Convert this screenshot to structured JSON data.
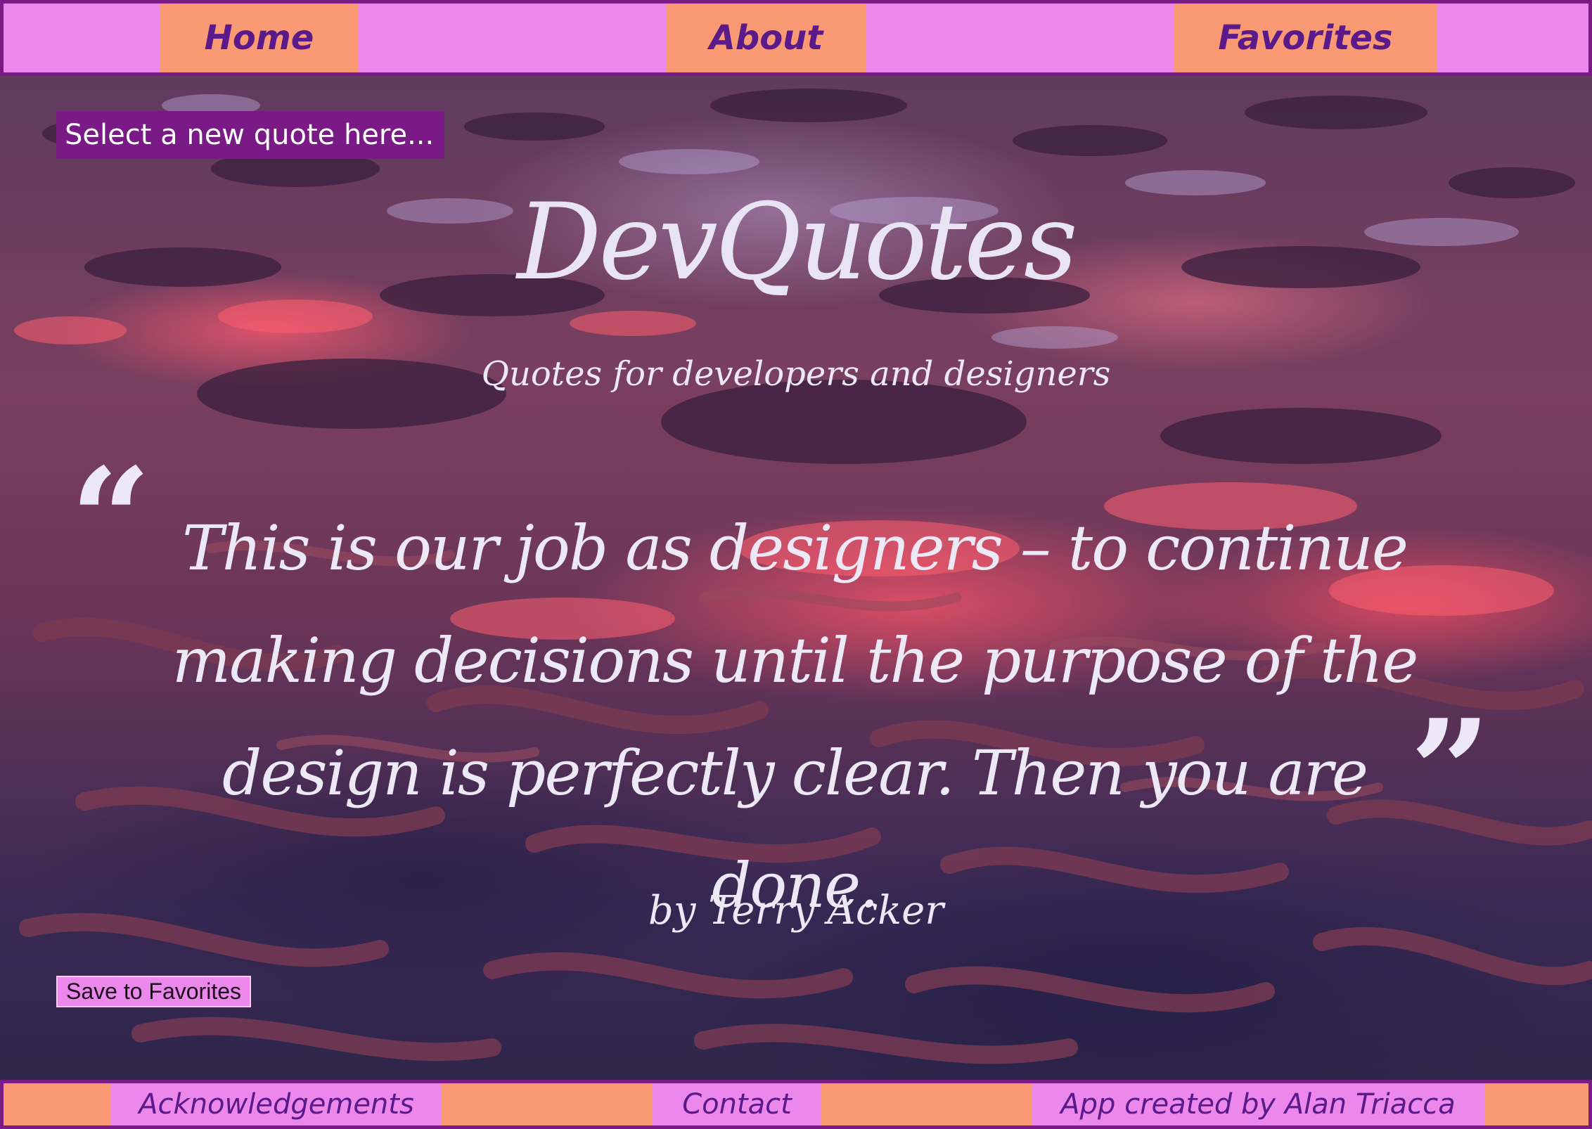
{
  "nav": {
    "home": "Home",
    "about": "About",
    "favorites": "Favorites"
  },
  "controls": {
    "select_quote": "Select a new quote here...",
    "save_favorites": "Save to Favorites"
  },
  "header": {
    "title": "DevQuotes",
    "subtitle": "Quotes for developers and designers"
  },
  "quote": {
    "open_mark": "“",
    "text": "This is our job as designers – to continue making decisions until the purpose of the design is perfectly clear. Then you are done.",
    "close_mark": "”",
    "author": "by Terry Acker"
  },
  "footer": {
    "acknowledgements": "Acknowledgements",
    "contact": "Contact",
    "credit": "App created by Alan Triacca"
  },
  "colors": {
    "nav_bg": "#ec88ec",
    "nav_item_bg": "#fa9a74",
    "border": "#7a1a86",
    "nav_text": "#5a1a8a",
    "quote_text": "#ece8f6"
  }
}
